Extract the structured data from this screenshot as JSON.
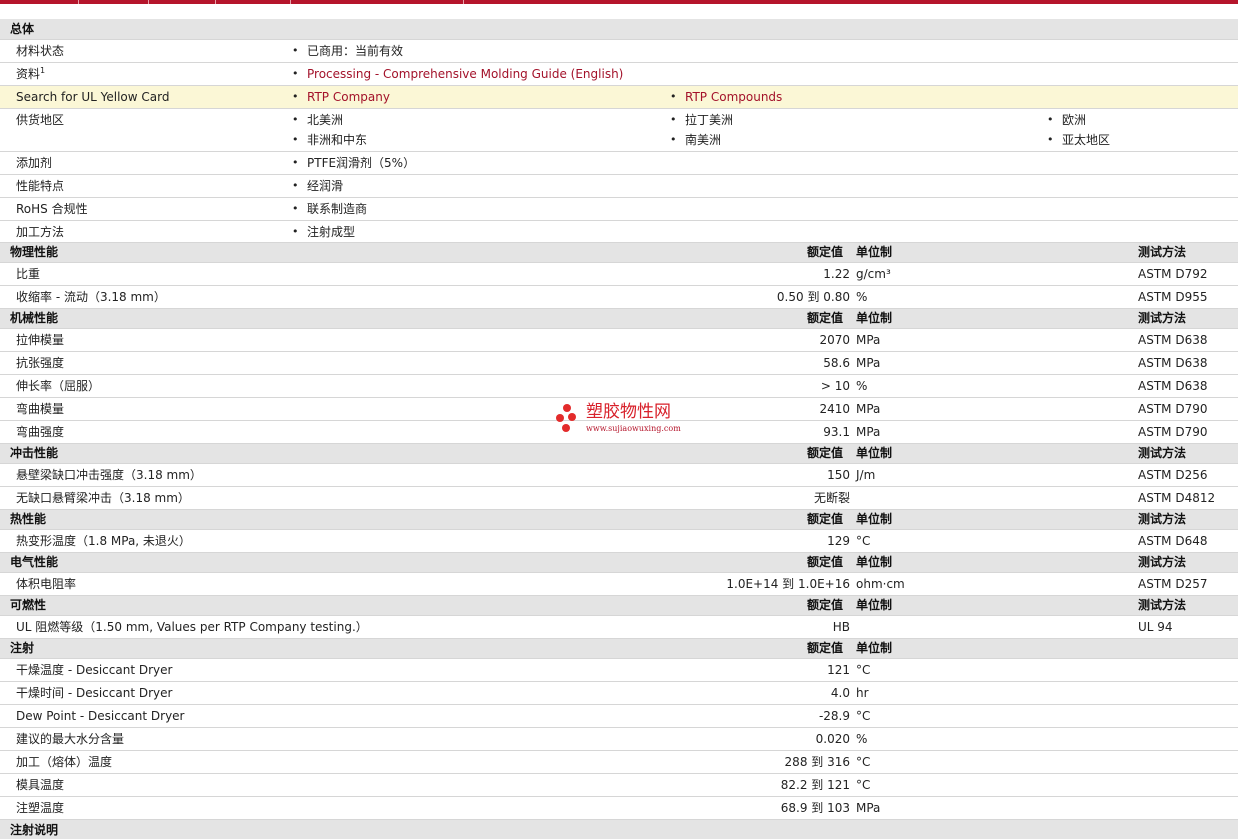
{
  "general": {
    "section_title": "总体",
    "material_status": {
      "label": "材料状态",
      "value": "已商用：当前有效"
    },
    "info": {
      "label": "资料",
      "sup": "1",
      "link": "Processing - Comprehensive Molding Guide (English)"
    },
    "ul": {
      "label": "Search for UL Yellow Card",
      "link1": "RTP Company",
      "link2": "RTP Compounds"
    },
    "supply": {
      "label": "供货地区",
      "regions": [
        "北美洲",
        "拉丁美洲",
        "欧洲",
        "非洲和中东",
        "南美洲",
        "亚太地区"
      ]
    },
    "additive": {
      "label": "添加剂",
      "value": "PTFE润滑剂（5%）"
    },
    "features": {
      "label": "性能特点",
      "value": "经润滑"
    },
    "rohs": {
      "label": "RoHS 合规性",
      "value": "联系制造商"
    },
    "processing": {
      "label": "加工方法",
      "value": "注射成型"
    }
  },
  "col_headers": {
    "nominal": "额定值",
    "unit": "单位制",
    "method": "测试方法"
  },
  "physical": {
    "title": "物理性能",
    "rows": [
      {
        "label": "比重",
        "value": "1.22",
        "unit": "g/cm³",
        "method": "ASTM D792"
      },
      {
        "label": "收缩率  - 流动（3.18 mm）",
        "value": "0.50 到  0.80",
        "unit": "%",
        "method": "ASTM D955"
      }
    ]
  },
  "mechanical": {
    "title": "机械性能",
    "rows": [
      {
        "label": "拉伸模量",
        "value": "2070",
        "unit": "MPa",
        "method": "ASTM D638"
      },
      {
        "label": "抗张强度",
        "value": "58.6",
        "unit": "MPa",
        "method": "ASTM D638"
      },
      {
        "label": "伸长率（屈服）",
        "value": "> 10",
        "unit": "%",
        "method": "ASTM D638"
      },
      {
        "label": "弯曲模量",
        "value": "2410",
        "unit": "MPa",
        "method": "ASTM D790"
      },
      {
        "label": "弯曲强度",
        "value": "93.1",
        "unit": "MPa",
        "method": "ASTM D790"
      }
    ]
  },
  "impact": {
    "title": "冲击性能",
    "rows": [
      {
        "label": "悬壁梁缺口冲击强度（3.18 mm）",
        "value": "150",
        "unit": "J/m",
        "method": "ASTM D256"
      },
      {
        "label": "无缺口悬臂梁冲击（3.18 mm）",
        "value": "无断裂",
        "unit": "",
        "method": "ASTM D4812"
      }
    ]
  },
  "thermal": {
    "title": "热性能",
    "rows": [
      {
        "label": "热变形温度（1.8 MPa, 未退火）",
        "value": "129",
        "unit": "°C",
        "method": "ASTM D648"
      }
    ]
  },
  "electrical": {
    "title": "电气性能",
    "rows": [
      {
        "label": "体积电阻率",
        "value": "1.0E+14 到  1.0E+16",
        "unit": "ohm·cm",
        "method": "ASTM D257"
      }
    ]
  },
  "flammability": {
    "title": "可燃性",
    "rows": [
      {
        "label": "UL 阻燃等级（1.50 mm, Values per RTP Company testing.）",
        "value": "HB",
        "unit": "",
        "method": "UL 94"
      }
    ]
  },
  "injection": {
    "title": "注射",
    "rows": [
      {
        "label": "干燥温度  - Desiccant Dryer",
        "value": "121",
        "unit": "°C"
      },
      {
        "label": "干燥时间  - Desiccant Dryer",
        "value": "4.0",
        "unit": "hr"
      },
      {
        "label": "Dew Point - Desiccant Dryer",
        "value": "-28.9",
        "unit": "°C"
      },
      {
        "label": "建议的最大水分含量",
        "value": "0.020",
        "unit": "%"
      },
      {
        "label": "加工（熔体）温度",
        "value": "288 到  316",
        "unit": "°C"
      },
      {
        "label": "模具温度",
        "value": "82.2 到  121",
        "unit": "°C"
      },
      {
        "label": "注塑温度",
        "value": "68.9 到  103",
        "unit": "MPa"
      }
    ]
  },
  "injection_notes": {
    "title": "注射说明"
  },
  "watermark": {
    "text": "塑胶物性网",
    "url": "www.sujiaowuxing.com"
  }
}
